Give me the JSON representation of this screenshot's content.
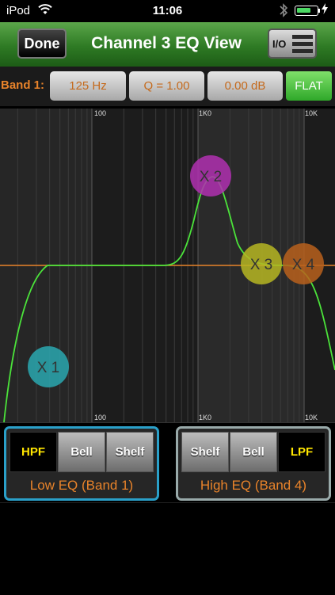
{
  "status_bar": {
    "carrier": "iPod",
    "time": "11:06"
  },
  "nav": {
    "done_label": "Done",
    "title": "Channel 3 EQ View",
    "io_label": "I/O"
  },
  "band_bar": {
    "label": "Band 1:",
    "frequency": "125 Hz",
    "q": "Q = 1.00",
    "gain": "0.00 dB",
    "flat_label": "FLAT"
  },
  "graph": {
    "tick_labels_top": [
      "100",
      "1K0",
      "10K"
    ],
    "tick_labels_bottom": [
      "100",
      "1K0",
      "10K"
    ],
    "nodes": [
      {
        "label": "X 1",
        "color": "#2aa8b0"
      },
      {
        "label": "X 2",
        "color": "#b030b0"
      },
      {
        "label": "X 3",
        "color": "#b6b622"
      },
      {
        "label": "X 4",
        "color": "#b8601c"
      }
    ],
    "colors": {
      "curve": "#4be33a",
      "zero_line": "#e8832a"
    }
  },
  "low_eq": {
    "buttons": [
      {
        "label": "HPF",
        "active": true
      },
      {
        "label": "Bell",
        "active": false
      },
      {
        "label": "Shelf",
        "active": false
      }
    ],
    "caption": "Low EQ (Band 1)"
  },
  "high_eq": {
    "buttons": [
      {
        "label": "Shelf",
        "active": false
      },
      {
        "label": "Bell",
        "active": false
      },
      {
        "label": "LPF",
        "active": true
      }
    ],
    "caption": "High EQ (Band 4)"
  }
}
